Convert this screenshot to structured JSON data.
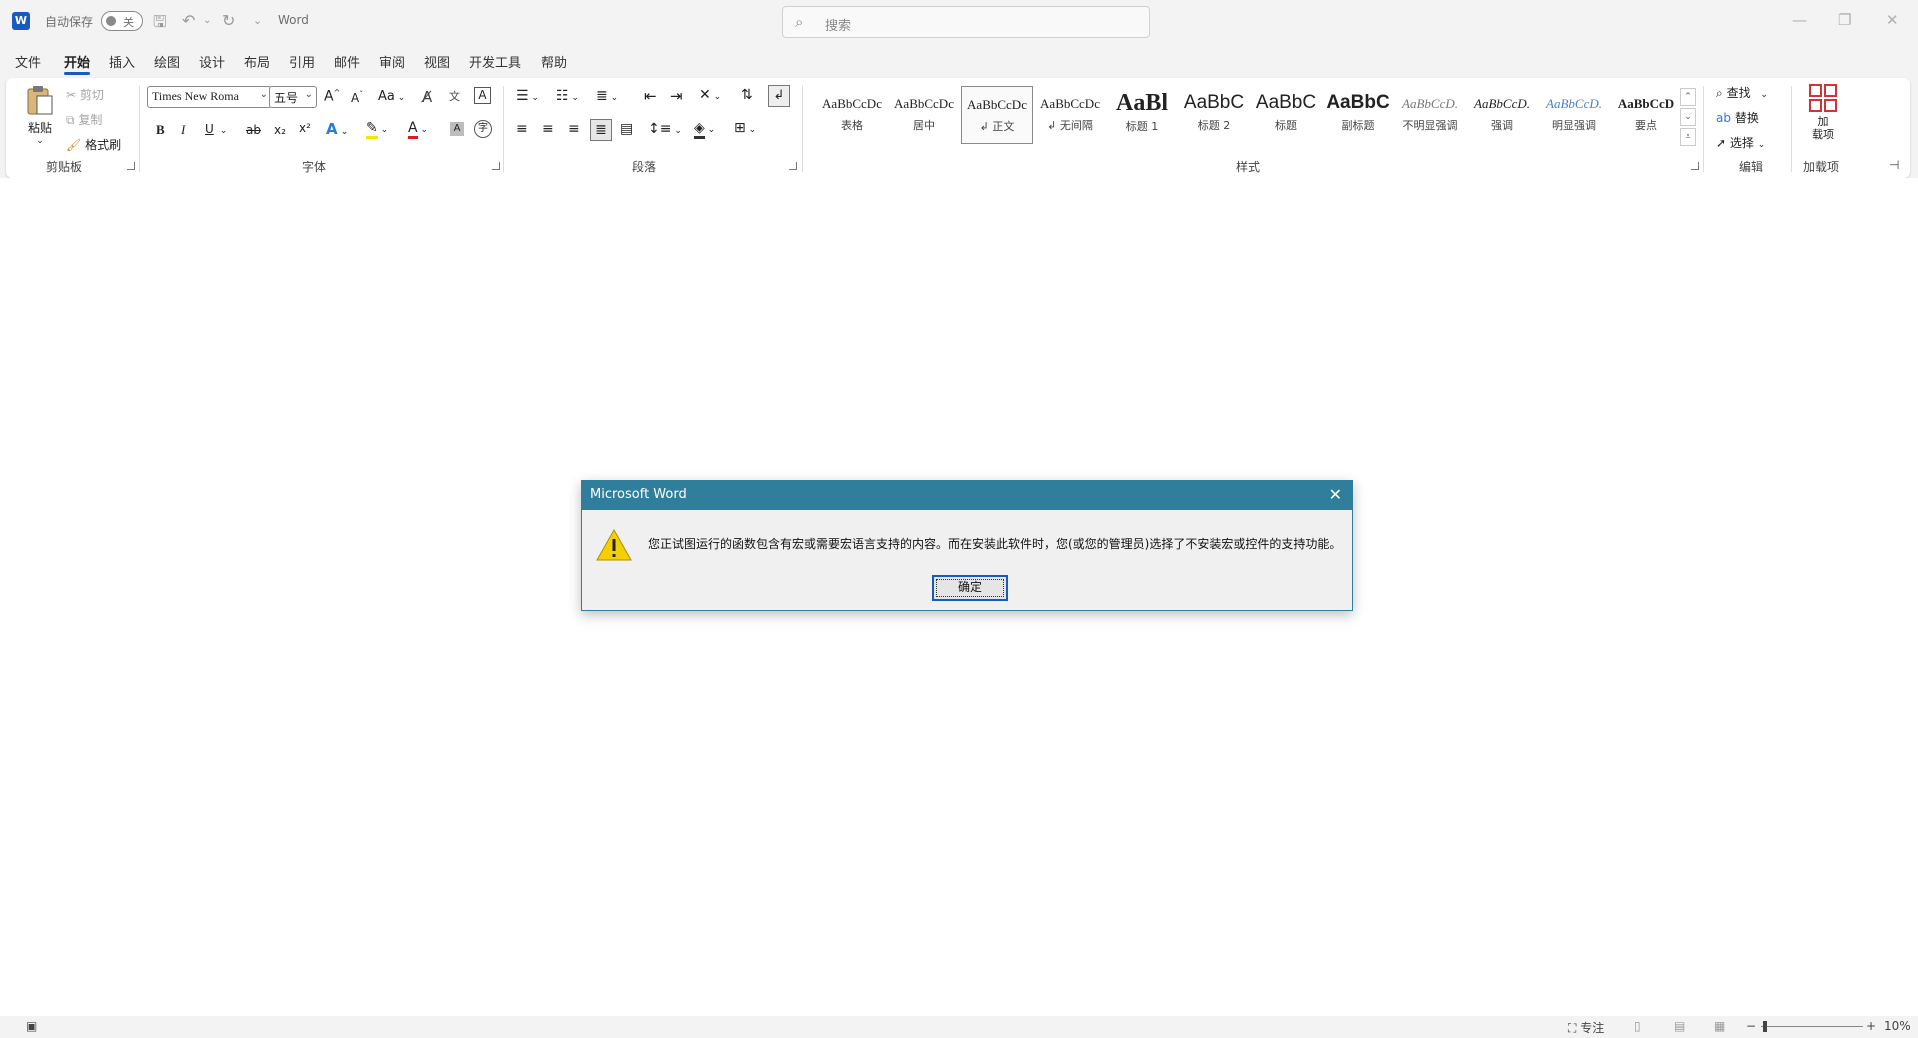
{
  "titlebar": {
    "logo": "W",
    "autosave_label": "自动保存",
    "autosave_state": "关",
    "app_name": "Word",
    "search_placeholder": "搜索"
  },
  "tabs": [
    "文件",
    "开始",
    "插入",
    "绘图",
    "设计",
    "布局",
    "引用",
    "邮件",
    "审阅",
    "视图",
    "开发工具",
    "帮助"
  ],
  "active_tab": "开始",
  "clipboard": {
    "paste": "粘贴",
    "cut": "剪切",
    "copy": "复制",
    "format_painter": "格式刷",
    "group": "剪贴板"
  },
  "font": {
    "font_name": "Times New Roma",
    "font_size": "五号",
    "group": "字体",
    "bold": "B",
    "italic": "I",
    "underline": "U",
    "strike": "ab",
    "sub": "x₂",
    "sup": "x²",
    "change_case": "Aa",
    "grow": "A",
    "shrink": "A"
  },
  "paragraph": {
    "group": "段落"
  },
  "styles": {
    "group": "样式",
    "items": [
      {
        "sample": "AaBbCcDc",
        "name": "表格"
      },
      {
        "sample": "AaBbCcDc",
        "name": "居中"
      },
      {
        "sample": "AaBbCcDc",
        "name": "↲ 正文"
      },
      {
        "sample": "AaBbCcDc",
        "name": "↲ 无间隔"
      },
      {
        "sample": "AaBl",
        "name": "标题 1"
      },
      {
        "sample": "AaBbC",
        "name": "标题 2"
      },
      {
        "sample": "AaBbC",
        "name": "标题"
      },
      {
        "sample": "AaBbC",
        "name": "副标题"
      },
      {
        "sample": "AaBbCcD.",
        "name": "不明显强调"
      },
      {
        "sample": "AaBbCcD.",
        "name": "强调"
      },
      {
        "sample": "AaBbCcD.",
        "name": "明显强调"
      },
      {
        "sample": "AaBbCcD",
        "name": "要点"
      }
    ]
  },
  "editing": {
    "find": "查找",
    "replace": "替换",
    "select": "选择",
    "group": "编辑"
  },
  "addins": {
    "button": "加\n载项",
    "button_line1": "加",
    "button_line2": "载项",
    "group": "加载项"
  },
  "statusbar": {
    "focus": "专注",
    "zoom_minus": "−",
    "zoom_plus": "+",
    "zoom": "10%"
  },
  "dialog": {
    "title": "Microsoft Word",
    "message": "您正试图运行的函数包含有宏或需要宏语言支持的内容。而在安装此软件时，您(或您的管理员)选择了不安装宏或控件的支持功能。",
    "ok": "确定"
  },
  "colors": {
    "accent": "#185abd",
    "dialog_title_bg": "#2f7f9c",
    "warning": "#f5d000"
  }
}
